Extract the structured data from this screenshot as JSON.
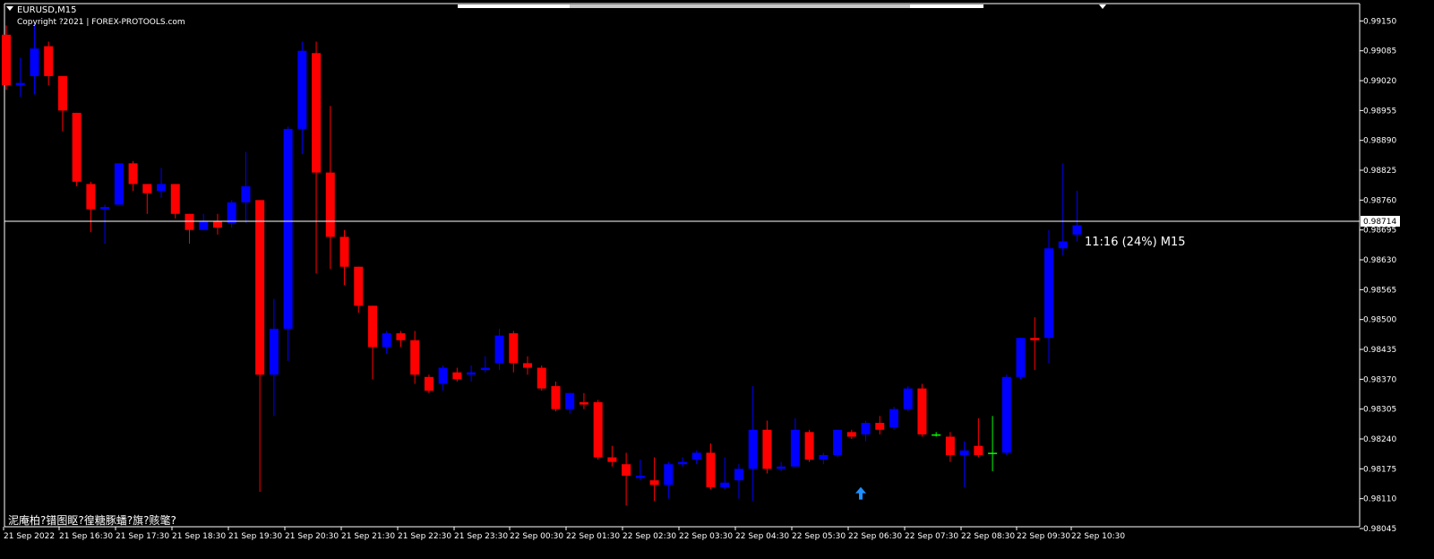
{
  "window": {
    "symbol_label": "EURUSD,M15",
    "copyright": "Copyright ?2021 | FOREX-PROTOOLS.com",
    "footer_text": "泥庵柏?镨图眍?徨糖豚蟠?旗?赅氅?"
  },
  "indicator": {
    "timer_text": "11:16 (24%) M15"
  },
  "colors": {
    "background": "#000000",
    "bull": "#0000ff",
    "bear": "#ff0000",
    "doji": "#00ff00",
    "axis": "#ffffff",
    "signal_arrow": "#1e90ff"
  },
  "chart_data": {
    "type": "candlestick",
    "symbol": "EURUSD",
    "timeframe": "M15",
    "ylim": [
      0.98045,
      0.9918
    ],
    "y_ticks": [
      "0.99150",
      "0.99085",
      "0.99020",
      "0.98955",
      "0.98890",
      "0.98825",
      "0.98760",
      "0.98695",
      "0.98630",
      "0.98565",
      "0.98500",
      "0.98435",
      "0.98370",
      "0.98305",
      "0.98240",
      "0.98175",
      "0.98110",
      "0.98045"
    ],
    "x_labels": [
      "21 Sep 2022",
      "21 Sep 16:30",
      "21 Sep 17:30",
      "21 Sep 18:30",
      "21 Sep 19:30",
      "21 Sep 20:30",
      "21 Sep 21:30",
      "21 Sep 22:30",
      "21 Sep 23:30",
      "22 Sep 00:30",
      "22 Sep 01:30",
      "22 Sep 02:30",
      "22 Sep 03:30",
      "22 Sep 04:30",
      "22 Sep 05:30",
      "22 Sep 06:30",
      "22 Sep 07:30",
      "22 Sep 08:30",
      "22 Sep 09:30",
      "22 Sep 10:30"
    ],
    "current_price": "0.98714",
    "candles": [
      {
        "o": 0.9912,
        "h": 0.9914,
        "l": 0.99,
        "c": 0.9901
      },
      {
        "o": 0.9901,
        "h": 0.9907,
        "l": 0.98985,
        "c": 0.99015
      },
      {
        "o": 0.9903,
        "h": 0.99145,
        "l": 0.9899,
        "c": 0.9909
      },
      {
        "o": 0.99095,
        "h": 0.99105,
        "l": 0.9901,
        "c": 0.9903
      },
      {
        "o": 0.9903,
        "h": 0.9903,
        "l": 0.9891,
        "c": 0.98955
      },
      {
        "o": 0.9895,
        "h": 0.9895,
        "l": 0.9879,
        "c": 0.988
      },
      {
        "o": 0.98795,
        "h": 0.988,
        "l": 0.9869,
        "c": 0.9874
      },
      {
        "o": 0.9874,
        "h": 0.9875,
        "l": 0.98665,
        "c": 0.98745
      },
      {
        "o": 0.9875,
        "h": 0.9884,
        "l": 0.9875,
        "c": 0.9884
      },
      {
        "o": 0.9884,
        "h": 0.98845,
        "l": 0.9878,
        "c": 0.98795
      },
      {
        "o": 0.98795,
        "h": 0.98795,
        "l": 0.9873,
        "c": 0.98775
      },
      {
        "o": 0.9878,
        "h": 0.9883,
        "l": 0.98765,
        "c": 0.98795
      },
      {
        "o": 0.98795,
        "h": 0.98795,
        "l": 0.9872,
        "c": 0.9873
      },
      {
        "o": 0.9873,
        "h": 0.9873,
        "l": 0.98665,
        "c": 0.98695
      },
      {
        "o": 0.98695,
        "h": 0.9873,
        "l": 0.98695,
        "c": 0.98715
      },
      {
        "o": 0.98715,
        "h": 0.9873,
        "l": 0.98685,
        "c": 0.987
      },
      {
        "o": 0.9871,
        "h": 0.9876,
        "l": 0.987,
        "c": 0.98755
      },
      {
        "o": 0.98755,
        "h": 0.98865,
        "l": 0.9871,
        "c": 0.9879
      },
      {
        "o": 0.9876,
        "h": 0.9876,
        "l": 0.98125,
        "c": 0.9838
      },
      {
        "o": 0.9838,
        "h": 0.98545,
        "l": 0.9829,
        "c": 0.9848
      },
      {
        "o": 0.9848,
        "h": 0.9892,
        "l": 0.9841,
        "c": 0.98915
      },
      {
        "o": 0.98915,
        "h": 0.99105,
        "l": 0.9886,
        "c": 0.99085
      },
      {
        "o": 0.9908,
        "h": 0.99105,
        "l": 0.986,
        "c": 0.9882
      },
      {
        "o": 0.9882,
        "h": 0.98965,
        "l": 0.9861,
        "c": 0.9868
      },
      {
        "o": 0.9868,
        "h": 0.98695,
        "l": 0.98575,
        "c": 0.98615
      },
      {
        "o": 0.98615,
        "h": 0.98615,
        "l": 0.98515,
        "c": 0.9853
      },
      {
        "o": 0.9853,
        "h": 0.9853,
        "l": 0.9837,
        "c": 0.9844
      },
      {
        "o": 0.9844,
        "h": 0.98475,
        "l": 0.98425,
        "c": 0.9847
      },
      {
        "o": 0.9847,
        "h": 0.98475,
        "l": 0.9844,
        "c": 0.98455
      },
      {
        "o": 0.98455,
        "h": 0.98475,
        "l": 0.9836,
        "c": 0.9838
      },
      {
        "o": 0.98375,
        "h": 0.9838,
        "l": 0.9834,
        "c": 0.98345
      },
      {
        "o": 0.9836,
        "h": 0.984,
        "l": 0.98345,
        "c": 0.98395
      },
      {
        "o": 0.98385,
        "h": 0.98395,
        "l": 0.98365,
        "c": 0.9837
      },
      {
        "o": 0.9838,
        "h": 0.984,
        "l": 0.98365,
        "c": 0.98385
      },
      {
        "o": 0.9839,
        "h": 0.9842,
        "l": 0.98385,
        "c": 0.98395
      },
      {
        "o": 0.98405,
        "h": 0.9848,
        "l": 0.9839,
        "c": 0.98465
      },
      {
        "o": 0.9847,
        "h": 0.98475,
        "l": 0.98385,
        "c": 0.98405
      },
      {
        "o": 0.98405,
        "h": 0.9842,
        "l": 0.9838,
        "c": 0.98395
      },
      {
        "o": 0.98395,
        "h": 0.984,
        "l": 0.98345,
        "c": 0.9835
      },
      {
        "o": 0.98355,
        "h": 0.98365,
        "l": 0.983,
        "c": 0.98305
      },
      {
        "o": 0.98305,
        "h": 0.9834,
        "l": 0.98295,
        "c": 0.9834
      },
      {
        "o": 0.9832,
        "h": 0.9834,
        "l": 0.98305,
        "c": 0.98315
      },
      {
        "o": 0.9832,
        "h": 0.98325,
        "l": 0.98195,
        "c": 0.982
      },
      {
        "o": 0.982,
        "h": 0.98225,
        "l": 0.9818,
        "c": 0.9819
      },
      {
        "o": 0.98185,
        "h": 0.9821,
        "l": 0.98095,
        "c": 0.9816
      },
      {
        "o": 0.98155,
        "h": 0.98195,
        "l": 0.9815,
        "c": 0.9816
      },
      {
        "o": 0.9815,
        "h": 0.982,
        "l": 0.98105,
        "c": 0.9814
      },
      {
        "o": 0.9814,
        "h": 0.9819,
        "l": 0.9811,
        "c": 0.98185
      },
      {
        "o": 0.98185,
        "h": 0.982,
        "l": 0.9818,
        "c": 0.9819
      },
      {
        "o": 0.98195,
        "h": 0.98215,
        "l": 0.98185,
        "c": 0.9821
      },
      {
        "o": 0.9821,
        "h": 0.9823,
        "l": 0.9813,
        "c": 0.98135
      },
      {
        "o": 0.98135,
        "h": 0.982,
        "l": 0.9813,
        "c": 0.98145
      },
      {
        "o": 0.9815,
        "h": 0.98185,
        "l": 0.9811,
        "c": 0.98175
      },
      {
        "o": 0.98175,
        "h": 0.98355,
        "l": 0.98105,
        "c": 0.9826
      },
      {
        "o": 0.9826,
        "h": 0.9828,
        "l": 0.98165,
        "c": 0.98175
      },
      {
        "o": 0.98175,
        "h": 0.9819,
        "l": 0.9817,
        "c": 0.9818
      },
      {
        "o": 0.9818,
        "h": 0.98285,
        "l": 0.9818,
        "c": 0.9826
      },
      {
        "o": 0.98255,
        "h": 0.9826,
        "l": 0.9819,
        "c": 0.98195
      },
      {
        "o": 0.98195,
        "h": 0.9821,
        "l": 0.98185,
        "c": 0.98205
      },
      {
        "o": 0.98205,
        "h": 0.9826,
        "l": 0.982,
        "c": 0.9826
      },
      {
        "o": 0.98255,
        "h": 0.9826,
        "l": 0.9824,
        "c": 0.98245
      },
      {
        "o": 0.9825,
        "h": 0.9828,
        "l": 0.98235,
        "c": 0.98275
      },
      {
        "o": 0.98275,
        "h": 0.9829,
        "l": 0.9825,
        "c": 0.9826
      },
      {
        "o": 0.98265,
        "h": 0.9831,
        "l": 0.9826,
        "c": 0.98305
      },
      {
        "o": 0.98305,
        "h": 0.98355,
        "l": 0.983,
        "c": 0.9835
      },
      {
        "o": 0.9835,
        "h": 0.9836,
        "l": 0.98245,
        "c": 0.9825
      },
      {
        "o": 0.9825,
        "h": 0.98255,
        "l": 0.98245,
        "c": 0.9825
      },
      {
        "o": 0.98245,
        "h": 0.98255,
        "l": 0.9819,
        "c": 0.98205
      },
      {
        "o": 0.98205,
        "h": 0.98235,
        "l": 0.98135,
        "c": 0.98215
      },
      {
        "o": 0.98225,
        "h": 0.98285,
        "l": 0.982,
        "c": 0.98205
      },
      {
        "o": 0.9821,
        "h": 0.9829,
        "l": 0.9817,
        "c": 0.9821
      },
      {
        "o": 0.9821,
        "h": 0.9838,
        "l": 0.98205,
        "c": 0.98375
      },
      {
        "o": 0.98375,
        "h": 0.9846,
        "l": 0.9837,
        "c": 0.9846
      },
      {
        "o": 0.9846,
        "h": 0.98505,
        "l": 0.9839,
        "c": 0.98455
      },
      {
        "o": 0.9846,
        "h": 0.98695,
        "l": 0.98405,
        "c": 0.98655
      },
      {
        "o": 0.98655,
        "h": 0.9884,
        "l": 0.9864,
        "c": 0.9867
      },
      {
        "o": 0.98685,
        "h": 0.9878,
        "l": 0.9867,
        "c": 0.98705
      }
    ],
    "signal_arrow": {
      "candle_index": 61,
      "direction": "up",
      "price": 0.9811
    }
  }
}
